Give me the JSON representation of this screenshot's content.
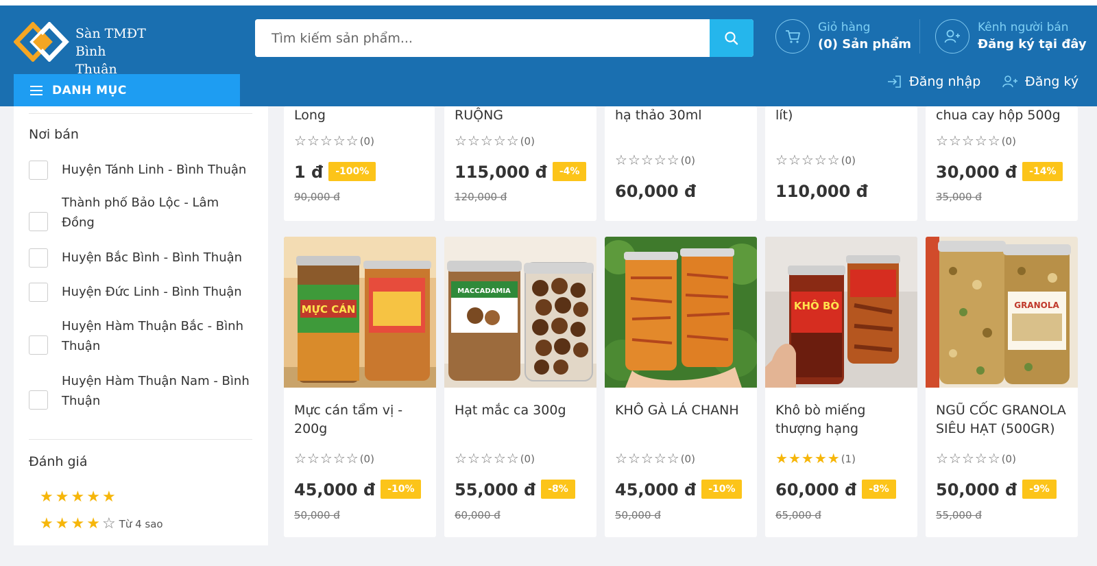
{
  "header": {
    "logo_line1": "Sàn TMĐT",
    "logo_line2": "Bình Thuận",
    "search_placeholder": "Tìm kiếm sản phẩm...",
    "cart_label": "Giỏ hàng",
    "cart_count": "(0) Sản phẩm",
    "seller_label": "Kênh người bán",
    "seller_action": "Đăng ký tại đây",
    "category_button": "DANH MỤC",
    "login": "Đăng nhập",
    "register": "Đăng ký"
  },
  "colors": {
    "header_bg": "#1a6fb0",
    "category_bg": "#1e9df2",
    "search_btn": "#25b6ec",
    "discount_badge": "#fcc419",
    "star": "#f6b60a"
  },
  "sidebar": {
    "seller_location_title": "Nơi bán",
    "locations": [
      {
        "label": "Huyện Tánh Linh - Bình Thuận"
      },
      {
        "label": "Thành phố Bảo Lộc - Lâm Đồng"
      },
      {
        "label": "Huyện Bắc Bình - Bình Thuận"
      },
      {
        "label": "Huyện Đức Linh - Bình Thuận"
      },
      {
        "label": "Huyện Hàm Thuận Bắc - Bình Thuận"
      },
      {
        "label": "Huyện Hàm Thuận Nam - Bình Thuận"
      }
    ],
    "rating_title": "Đánh giá",
    "rating_filters": [
      {
        "stars": 5,
        "label": ""
      },
      {
        "stars": 4,
        "label": "Từ 4 sao"
      }
    ]
  },
  "products_top": [
    {
      "name": "Long",
      "rating": 0,
      "reviews": "(0)",
      "price": "1 đ",
      "discount": "-100%",
      "old_price": "90,000 đ"
    },
    {
      "name": "RUỘNG",
      "rating": 0,
      "reviews": "(0)",
      "price": "115,000 đ",
      "discount": "-4%",
      "old_price": "120,000 đ"
    },
    {
      "name": "hạ thảo 30ml",
      "rating": 0,
      "reviews": "(0)",
      "price": "60,000 đ",
      "discount": "",
      "old_price": ""
    },
    {
      "name": "lít)",
      "rating": 0,
      "reviews": "(0)",
      "price": "110,000 đ",
      "discount": "",
      "old_price": ""
    },
    {
      "name": "chua cay hộp 500g",
      "rating": 0,
      "reviews": "(0)",
      "price": "30,000 đ",
      "discount": "-14%",
      "old_price": "35,000 đ"
    }
  ],
  "products": [
    {
      "name": "Mực cán tẩm vị - 200g",
      "image_icon": "squid-jar-image",
      "label_text": "MỰC CÁN",
      "rating": 0,
      "reviews": "(0)",
      "price": "45,000 đ",
      "discount": "-10%",
      "old_price": "50,000 đ"
    },
    {
      "name": "Hạt mắc ca 300g",
      "image_icon": "macadamia-jar-image",
      "label_text": "MACCADAMIA",
      "rating": 0,
      "reviews": "(0)",
      "price": "55,000 đ",
      "discount": "-8%",
      "old_price": "60,000 đ"
    },
    {
      "name": "KHÔ GÀ LÁ CHANH",
      "image_icon": "chicken-jar-image",
      "label_text": "",
      "rating": 0,
      "reviews": "(0)",
      "price": "45,000 đ",
      "discount": "-10%",
      "old_price": "50,000 đ"
    },
    {
      "name": "Khô bò miếng thượng hạng",
      "image_icon": "beef-jar-image",
      "label_text": "KHÔ BÒ",
      "rating": 5,
      "reviews": "(1)",
      "price": "60,000 đ",
      "discount": "-8%",
      "old_price": "65,000 đ"
    },
    {
      "name": "NGŨ CỐC GRANOLA SIÊU HẠT (500GR)",
      "image_icon": "granola-jar-image",
      "label_text": "GRANOLA",
      "rating": 0,
      "reviews": "(0)",
      "price": "50,000 đ",
      "discount": "-9%",
      "old_price": "55,000 đ"
    }
  ]
}
